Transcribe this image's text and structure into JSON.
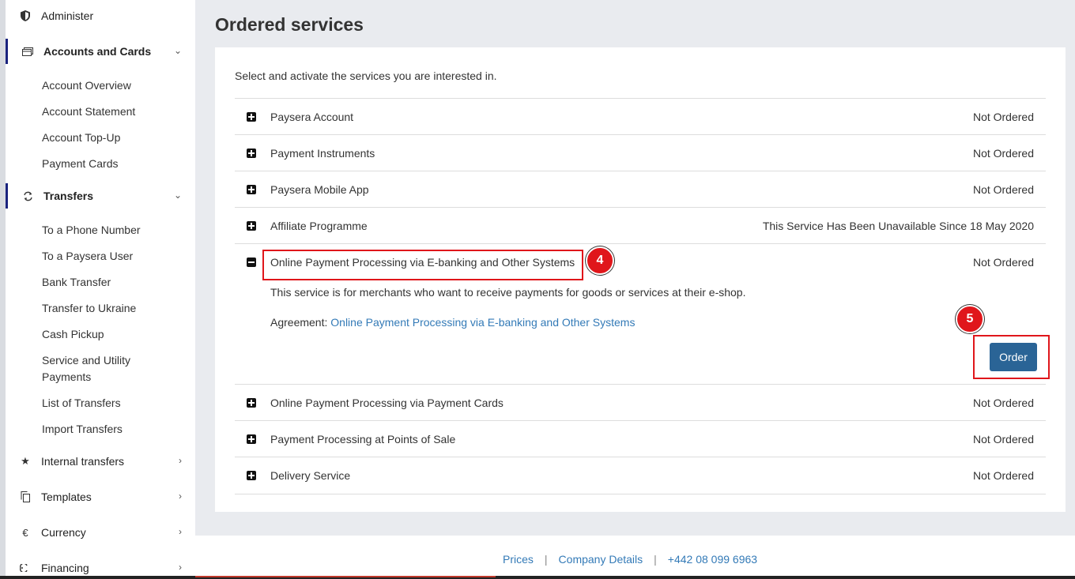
{
  "sidebar": {
    "administer": "Administer",
    "accounts_and_cards": {
      "label": "Accounts and Cards",
      "items": [
        "Account Overview",
        "Account Statement",
        "Account Top-Up",
        "Payment Cards"
      ]
    },
    "transfers": {
      "label": "Transfers",
      "items": [
        "To a Phone Number",
        "To a Paysera User",
        "Bank Transfer",
        "Transfer to Ukraine",
        "Cash Pickup",
        "Service and Utility Payments",
        "List of Transfers",
        "Import Transfers"
      ]
    },
    "internal_transfers": "Internal transfers",
    "templates": "Templates",
    "currency": "Currency",
    "financing": "Financing",
    "icons": {
      "administer": "shield-icon",
      "accounts": "cards-icon",
      "transfers": "sync-icon",
      "internal": "star-icon",
      "templates": "copy-icon",
      "currency": "euro-icon",
      "financing": "financing-icon"
    }
  },
  "main": {
    "title": "Ordered services",
    "intro": "Select and activate the services you are interested in.",
    "services": [
      {
        "name": "Paysera Account",
        "status": "Not Ordered"
      },
      {
        "name": "Payment Instruments",
        "status": "Not Ordered"
      },
      {
        "name": "Paysera Mobile App",
        "status": "Not Ordered"
      },
      {
        "name": "Affiliate Programme",
        "status": "This Service Has Been Unavailable Since 18 May 2020"
      },
      {
        "name": "Online Payment Processing via E-banking and Other Systems",
        "status": "Not Ordered"
      },
      {
        "name": "Online Payment Processing via Payment Cards",
        "status": "Not Ordered"
      },
      {
        "name": "Payment Processing at Points of Sale",
        "status": "Not Ordered"
      },
      {
        "name": "Delivery Service",
        "status": "Not Ordered"
      }
    ],
    "expanded": {
      "description": "This service is for merchants who want to receive payments for goods or services at their e-shop.",
      "agreement_label": "Agreement:",
      "agreement_link": "Online Payment Processing via E-banking and Other Systems",
      "order_button": "Order"
    }
  },
  "annotations": {
    "step4": "4",
    "step5": "5",
    "color": "#e0161b"
  },
  "footer": {
    "prices": "Prices",
    "company_details": "Company Details",
    "phone": "+442 08 099 6963",
    "separator": "|"
  }
}
